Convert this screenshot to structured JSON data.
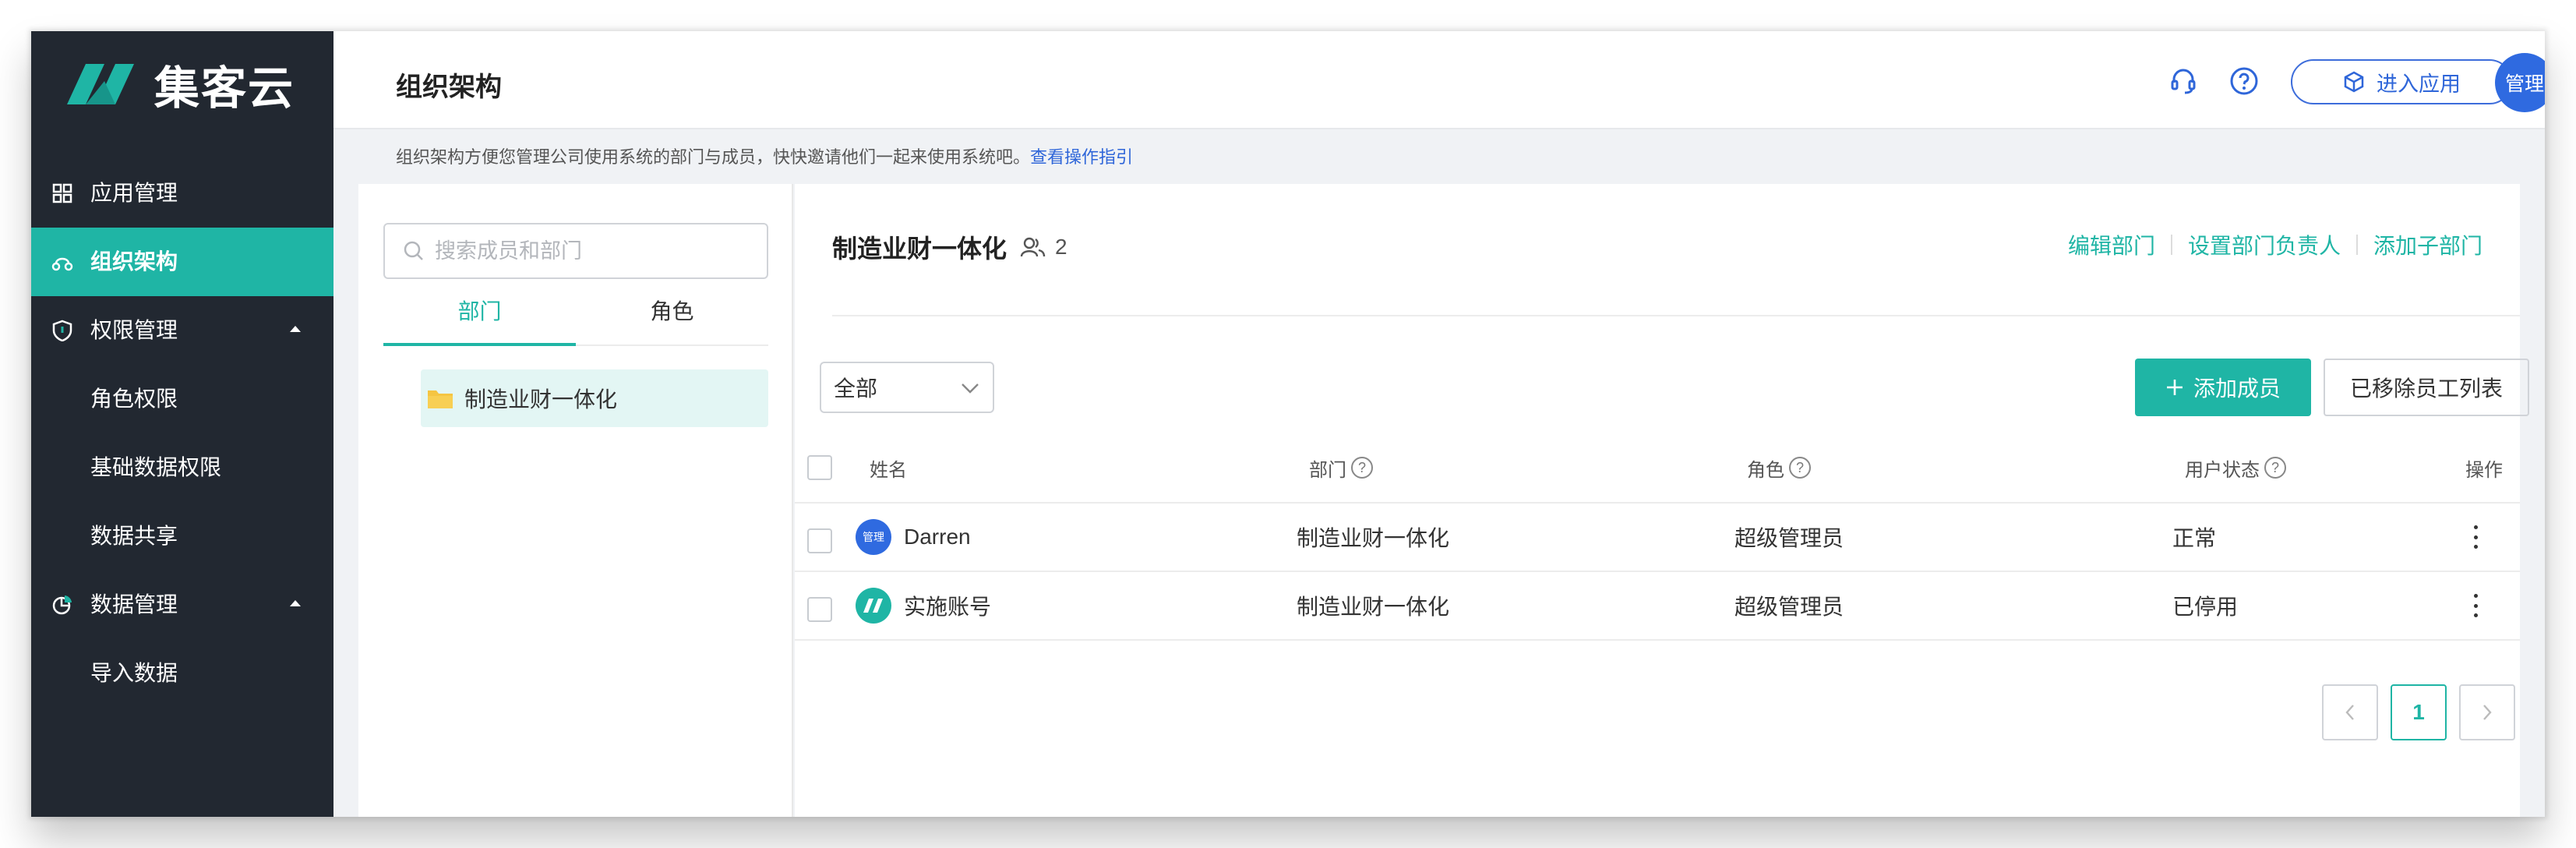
{
  "app": {
    "brand": "集客云"
  },
  "sidebar": {
    "items": [
      {
        "label": "应用管理",
        "icon": "apps-grid-icon"
      },
      {
        "label": "组织架构",
        "icon": "org-structure-icon",
        "active": true
      },
      {
        "label": "权限管理",
        "icon": "shield-icon",
        "expanded": true
      },
      {
        "label": "角色权限",
        "sub": true
      },
      {
        "label": "基础数据权限",
        "sub": true
      },
      {
        "label": "数据共享",
        "sub": true
      },
      {
        "label": "数据管理",
        "icon": "pie-chart-icon",
        "expanded": true
      },
      {
        "label": "导入数据",
        "sub": true
      }
    ]
  },
  "header": {
    "title": "组织架构",
    "enter_app_label": "进入应用",
    "avatar_text": "管理"
  },
  "notice": {
    "text": "组织架构方便您管理公司使用系统的部门与成员，快快邀请他们一起来使用系统吧。",
    "link": "查看操作指引"
  },
  "left_panel": {
    "search_placeholder": "搜索成员和部门",
    "tabs": [
      "部门",
      "角色"
    ],
    "active_tab": "部门",
    "tree": [
      {
        "label": "制造业财一体化"
      }
    ]
  },
  "department": {
    "name": "制造业财一体化",
    "member_count": "2",
    "actions": [
      "编辑部门",
      "设置部门负责人",
      "添加子部门"
    ]
  },
  "toolbar": {
    "filter_value": "全部",
    "add_member_label": "添加成员",
    "removed_list_label": "已移除员工列表"
  },
  "table": {
    "headers": {
      "name": "姓名",
      "dept": "部门",
      "role": "角色",
      "status": "用户状态",
      "ops": "操作"
    },
    "rows": [
      {
        "avatar": "管理",
        "name": "Darren",
        "dept": "制造业财一体化",
        "role": "超级管理员",
        "status": "正常"
      },
      {
        "avatar": "logo",
        "name": "实施账号",
        "dept": "制造业财一体化",
        "role": "超级管理员",
        "status": "已停用"
      }
    ]
  },
  "pagination": {
    "current": "1"
  },
  "colors": {
    "accent": "#1fb5a5",
    "sidebar_bg": "#222831",
    "link_blue": "#2f66d9"
  }
}
